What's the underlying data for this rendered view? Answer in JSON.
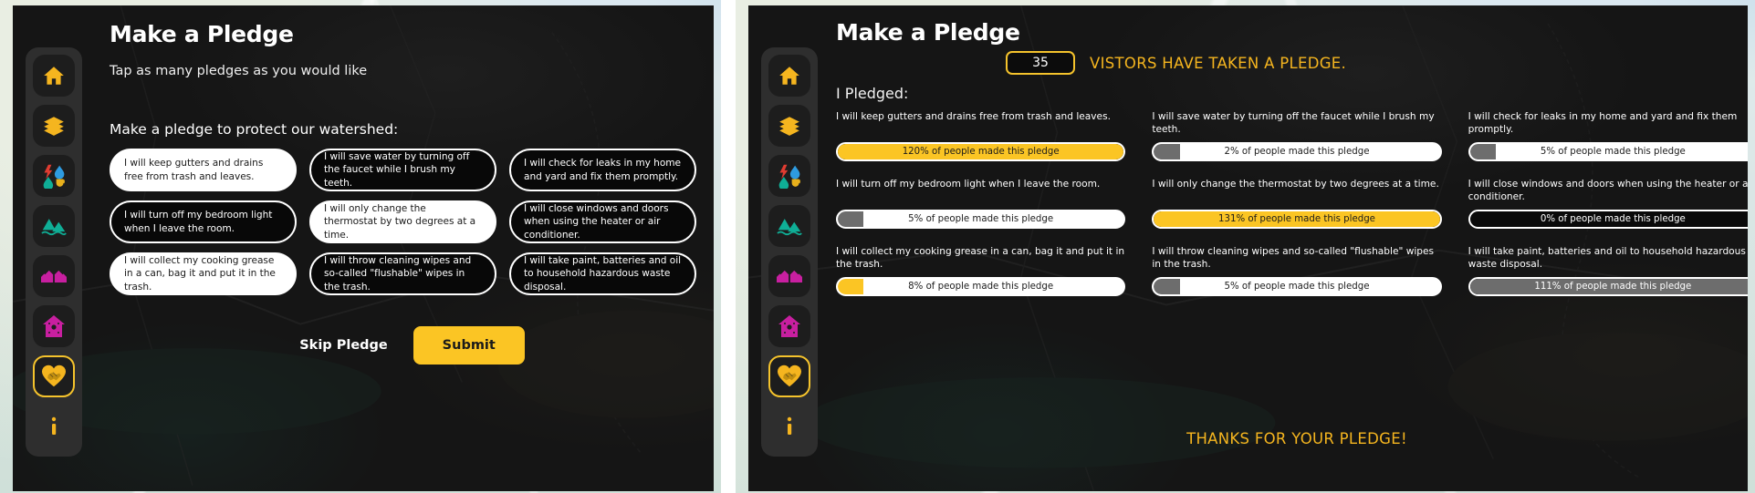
{
  "sidebar": {
    "items": [
      {
        "name": "home",
        "icon": "home-icon",
        "active": false
      },
      {
        "name": "layers",
        "icon": "layers-icon",
        "active": false
      },
      {
        "name": "utilities",
        "icon": "energy-water-icon",
        "active": false
      },
      {
        "name": "watershed",
        "icon": "mountains-water-icon",
        "active": false
      },
      {
        "name": "neighborhood",
        "icon": "houses-icon",
        "active": false
      },
      {
        "name": "home-detail",
        "icon": "birdhouse-icon",
        "active": false
      },
      {
        "name": "pledge",
        "icon": "handshake-heart-icon",
        "active": true
      },
      {
        "name": "info",
        "icon": "info-icon",
        "active": false
      }
    ]
  },
  "left_panel": {
    "title": "Make a Pledge",
    "subtitle": "Tap as many pledges as you would like",
    "section_label": "Make a pledge to protect our watershed:",
    "pledges": [
      {
        "text": "I will keep gutters and drains free from trash and leaves.",
        "selected": true
      },
      {
        "text": "I will save water by turning off the faucet while I brush my teeth.",
        "selected": false
      },
      {
        "text": "I will check for leaks in my home and yard and fix them promptly.",
        "selected": false
      },
      {
        "text": "I will turn off my bedroom light when I leave the room.",
        "selected": false
      },
      {
        "text": "I will only change the thermostat by two degrees at a time.",
        "selected": true
      },
      {
        "text": "I will close windows and doors when using the heater or air conditioner.",
        "selected": false
      },
      {
        "text": "I will collect my cooking grease in a can, bag it and put it in the trash.",
        "selected": true
      },
      {
        "text": "I will throw cleaning wipes and so-called \"flushable\" wipes in the trash.",
        "selected": false
      },
      {
        "text": "I will take paint, batteries and oil to household hazardous waste disposal.",
        "selected": false
      }
    ],
    "skip_label": "Skip Pledge",
    "submit_label": "Submit"
  },
  "right_panel": {
    "title": "Make a Pledge",
    "visitor_count": "35",
    "visitor_text": "VISTORS HAVE TAKEN A PLEDGE.",
    "pledged_label": "I Pledged:",
    "thanks_text": "THANKS FOR YOUR PLEDGE!",
    "results": [
      {
        "text": "I will keep gutters and drains free from trash and leaves.",
        "bar_label": "120% of people made this pledge",
        "percent": 120,
        "fill": "gold"
      },
      {
        "text": "I will save water by turning off the faucet while I brush my teeth.",
        "bar_label": "2% of people made this pledge",
        "percent": 2,
        "fill": "grey"
      },
      {
        "text": "I will check for leaks in my home and yard and fix them promptly.",
        "bar_label": "5% of people made this pledge",
        "percent": 5,
        "fill": "grey"
      },
      {
        "text": "I will turn off my bedroom light when I leave the room.",
        "bar_label": "5% of people made this pledge",
        "percent": 5,
        "fill": "grey"
      },
      {
        "text": "I will only change the thermostat by two degrees at a time.",
        "bar_label": "131% of people made this pledge",
        "percent": 131,
        "fill": "gold"
      },
      {
        "text": "I will close windows and doors when using the heater or air conditioner.",
        "bar_label": "0% of people made this pledge",
        "percent": 0,
        "fill": "grey"
      },
      {
        "text": "I will collect my cooking grease in a can, bag it and put it in the trash.",
        "bar_label": "8% of people made this pledge",
        "percent": 8,
        "fill": "gold"
      },
      {
        "text": "I will throw cleaning wipes and so-called \"flushable\" wipes in the trash.",
        "bar_label": "5% of people made this pledge",
        "percent": 5,
        "fill": "grey"
      },
      {
        "text": "I will take paint, batteries and oil to household hazardous waste disposal.",
        "bar_label": "111% of people made this pledge",
        "percent": 111,
        "fill": "grey"
      }
    ]
  },
  "colors": {
    "accent_gold": "#fbc524",
    "accent_amber": "#f5b51f",
    "card_bg": "#151515",
    "sidebar_bg": "#2e2e2e"
  }
}
